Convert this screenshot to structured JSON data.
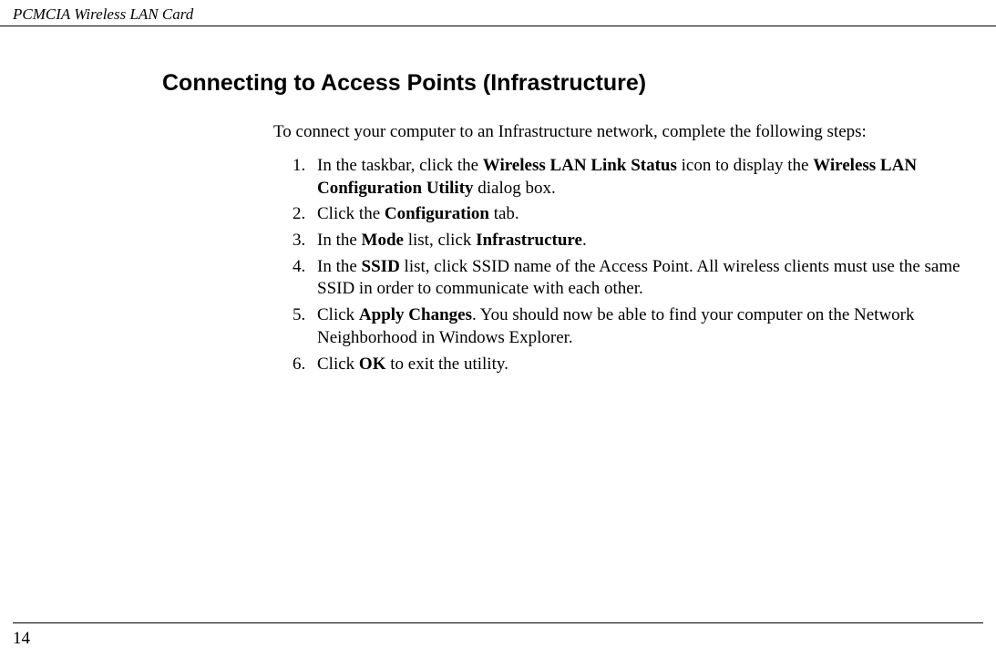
{
  "header": "PCMCIA Wireless LAN Card",
  "title": "Connecting to Access Points (Infrastructure)",
  "intro": "To connect your computer to an Infrastructure network, complete the following steps:",
  "steps": {
    "s1a": "In the taskbar, click the ",
    "s1b": "Wireless LAN Link Status",
    "s1c": " icon to display the ",
    "s1d": "Wireless LAN Configuration Utility",
    "s1e": " dialog box.",
    "s2a": "Click the ",
    "s2b": "Configuration",
    "s2c": " tab.",
    "s3a": "In the ",
    "s3b": "Mode",
    "s3c": " list, click ",
    "s3d": "Infrastructure",
    "s3e": ".",
    "s4a": "In the ",
    "s4b": "SSID",
    "s4c": " list, click SSID name of the Access Point. All wireless clients must use the same SSID in order to communicate with each other.",
    "s5a": "Click ",
    "s5b": "Apply Changes",
    "s5c": ". You should now be able to find your computer on the Network Neighborhood in Windows Explorer.",
    "s6a": "Click ",
    "s6b": "OK",
    "s6c": " to exit the utility."
  },
  "pageNumber": "14"
}
